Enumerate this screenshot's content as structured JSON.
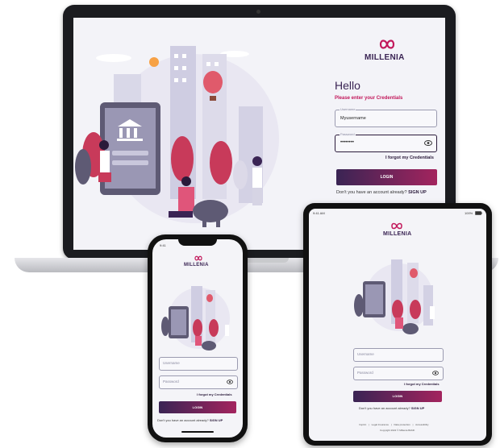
{
  "brand": {
    "name": "MILLENIA",
    "colors": {
      "primary": "#3a2454",
      "accent": "#a3245e",
      "crimson": "#c2185b"
    }
  },
  "laptop": {
    "hello": "Hello",
    "subtitle": "Please enter your Credentials",
    "username_label": "Username",
    "username_value": "Myusername",
    "password_label": "Password",
    "password_value": "••••••••",
    "forgot": "I forgot my Credentials",
    "login": "LOGIN",
    "no_account": "Don't you have an account already?",
    "signup": "SIGN UP"
  },
  "phone": {
    "time": "9:41",
    "username_placeholder": "Username",
    "password_placeholder": "Password",
    "forgot": "I forgot my Credentials",
    "login": "LOGIN",
    "no_account": "Don't you have an account already?",
    "signup": "SIGN UP"
  },
  "tablet": {
    "time": "9:41 AM",
    "battery": "100%",
    "username_placeholder": "Username",
    "password_placeholder": "Password",
    "forgot": "I forgot my Credentials",
    "login": "LOGIN",
    "no_account": "Don't you have an account already?",
    "signup": "SIGN UP",
    "footer_links": [
      "Imprint",
      "Legal Insurance",
      "Data protection",
      "Accessibility"
    ],
    "copyright": "Copyright 2022 © Millenia BANK"
  },
  "icons": [
    "millenia-logo-icon",
    "eye-icon",
    "bank-building-icon",
    "hot-air-balloon-icon",
    "piggy-bank-icon",
    "battery-icon"
  ]
}
